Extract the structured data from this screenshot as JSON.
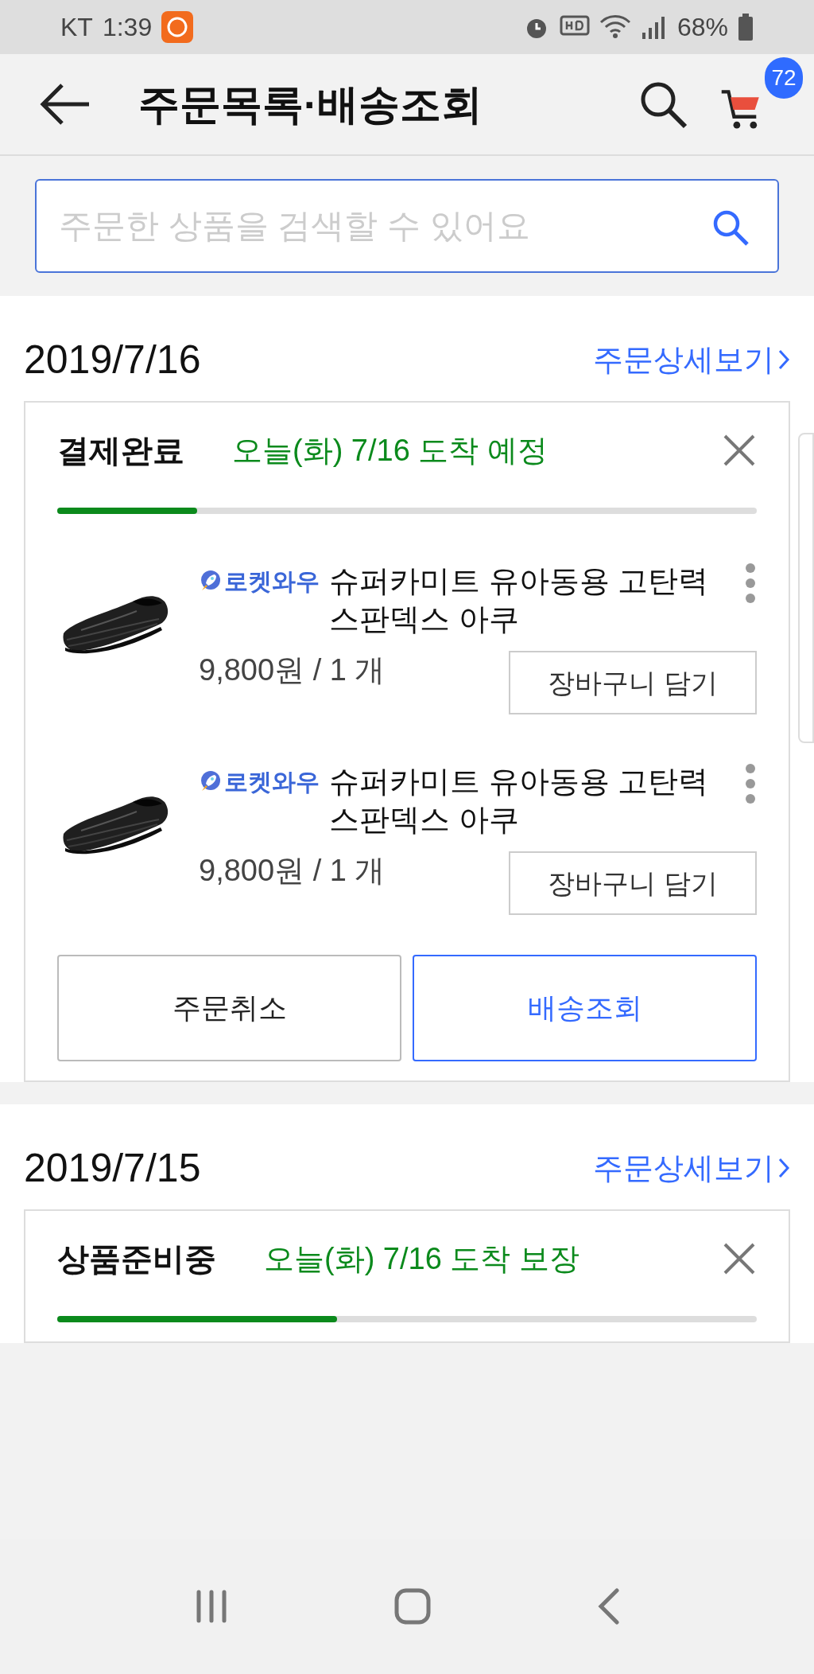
{
  "status_bar": {
    "carrier": "KT",
    "time": "1:39",
    "battery": "68%"
  },
  "header": {
    "title": "주문목록·배송조회",
    "cart_count": "72"
  },
  "search": {
    "placeholder": "주문한 상품을 검색할 수 있어요"
  },
  "orders": [
    {
      "date": "2019/7/16",
      "detail_link": "주문상세보기",
      "status": "결제완료",
      "delivery": "오늘(화) 7/16 도착 예정",
      "progress": {
        "level": 0.2
      },
      "items": [
        {
          "badge": "로켓와우",
          "title": "슈퍼카미트 유아동용 고탄력 스판덱스 아쿠",
          "price": "9,800원 / 1 개",
          "cart_button": "장바구니 담기"
        },
        {
          "badge": "로켓와우",
          "title": "슈퍼카미트 유아동용 고탄력 스판덱스 아쿠",
          "price": "9,800원 / 1 개",
          "cart_button": "장바구니 담기"
        }
      ],
      "actions": [
        {
          "label": "주문취소",
          "kind": "default"
        },
        {
          "label": "배송조회",
          "kind": "primary"
        }
      ]
    },
    {
      "date": "2019/7/15",
      "detail_link": "주문상세보기",
      "status": "상품준비중",
      "delivery": "오늘(화) 7/16 도착 보장",
      "progress": {
        "level": 0.4
      }
    }
  ]
}
